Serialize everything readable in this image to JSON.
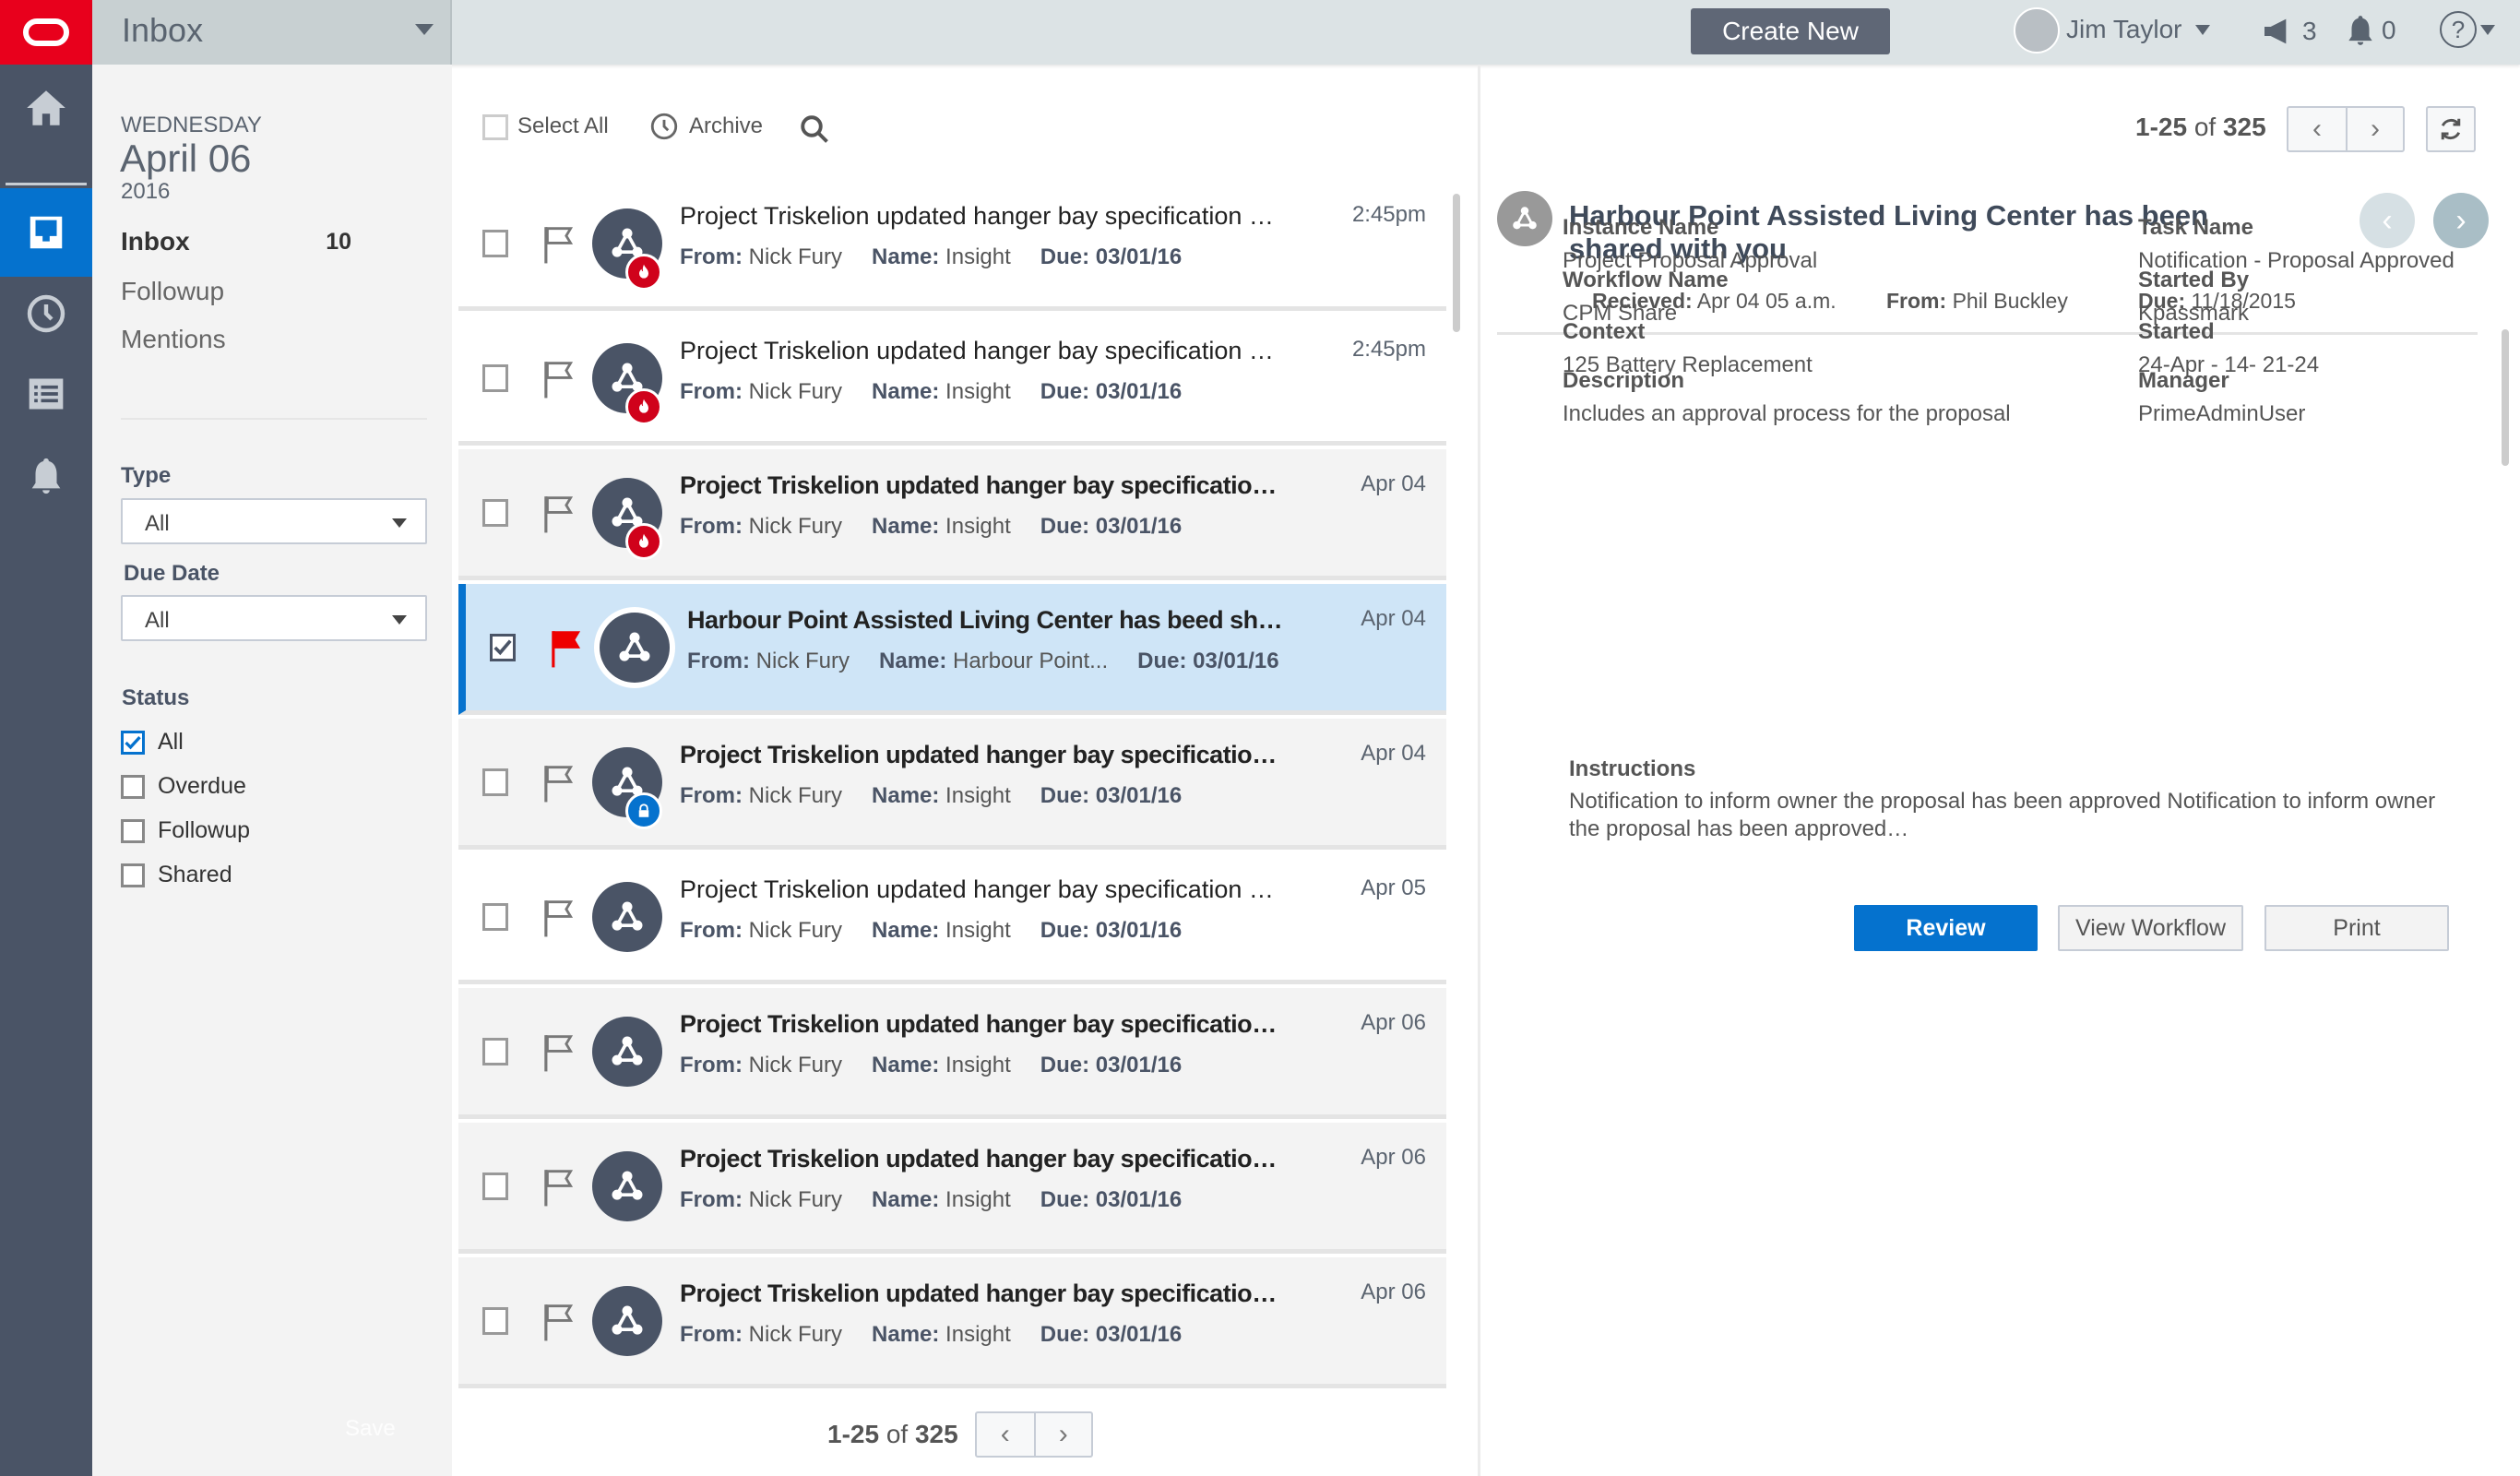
{
  "app": {
    "section_title": "Inbox",
    "create_new": "Create New",
    "user_name": "Jim Taylor",
    "announcements_count": "3",
    "notifications_count": "0",
    "help": "?",
    "accent": "#0572ce",
    "brand": "#e8001c"
  },
  "rail": {
    "items": [
      "home-icon",
      "inbox-icon",
      "history-icon",
      "list-icon",
      "bell-icon"
    ],
    "active": "inbox-icon"
  },
  "left": {
    "weekday": "WEDNESDAY",
    "date": "April 06",
    "year": "2016",
    "nav": [
      {
        "label": "Inbox",
        "count": "10"
      },
      {
        "label": "Followup"
      },
      {
        "label": "Mentions"
      }
    ],
    "type_label": "Type",
    "type_value": "All",
    "due_label": "Due Date",
    "due_value": "All",
    "status_label": "Status",
    "status": [
      {
        "label": "All",
        "checked": true
      },
      {
        "label": "Overdue",
        "checked": false
      },
      {
        "label": "Followup",
        "checked": false
      },
      {
        "label": "Shared",
        "checked": false
      }
    ],
    "save": "Save"
  },
  "toolbar": {
    "select_all": "Select All",
    "archive": "Archive",
    "pager": {
      "range": "1-25",
      "of": "of",
      "total": "325"
    }
  },
  "rows": [
    {
      "title": "Project Triskelion updated hanger bay specification are…",
      "from": "Nick Fury",
      "name": "Insight",
      "due": "03/01/16",
      "time": "2:45pm",
      "badge": "fire",
      "bold": false,
      "bg": "white"
    },
    {
      "title": "Project Triskelion updated hanger bay specification are…",
      "from": "Nick Fury",
      "name": "Insight",
      "due": "03/01/16",
      "time": "2:45pm",
      "badge": "fire",
      "bold": false,
      "bg": "white"
    },
    {
      "title": "Project Triskelion updated hanger bay specification...",
      "from": "Nick Fury",
      "name": "Insight",
      "due": "03/01/16",
      "time": "Apr 04",
      "badge": "fire",
      "bold": true,
      "bg": "grey"
    },
    {
      "title": "Harbour Point Assisted Living Center has beed shar...",
      "from": "Nick Fury",
      "name": "Harbour Point...",
      "due": "03/01/16",
      "time": "Apr 04",
      "badge": "",
      "bold": true,
      "bg": "selected",
      "checked": true,
      "flagged": true
    },
    {
      "title": "Project Triskelion updated hanger bay specification...",
      "from": "Nick Fury",
      "name": "Insight",
      "due": "03/01/16",
      "time": "Apr 04",
      "badge": "lock",
      "bold": true,
      "bg": "grey"
    },
    {
      "title": "Project Triskelion updated hanger bay specification are…",
      "from": "Nick Fury",
      "name": "Insight",
      "due": "03/01/16",
      "time": "Apr 05",
      "badge": "",
      "bold": false,
      "bg": "white"
    },
    {
      "title": "Project Triskelion updated hanger bay specification are...",
      "from": "Nick Fury",
      "name": "Insight",
      "due": "03/01/16",
      "time": "Apr 06",
      "badge": "",
      "bold": true,
      "bg": "grey"
    },
    {
      "title": "Project Triskelion updated hanger bay specification are...",
      "from": "Nick Fury",
      "name": "Insight",
      "due": "03/01/16",
      "time": "Apr 06",
      "badge": "",
      "bold": true,
      "bg": "grey"
    },
    {
      "title": "Project Triskelion updated hanger bay specification are...",
      "from": "Nick Fury",
      "name": "Insight",
      "due": "03/01/16",
      "time": "Apr 06",
      "badge": "",
      "bold": true,
      "bg": "grey"
    }
  ],
  "row_labels": {
    "from": "From:",
    "name": "Name:",
    "due": "Due:"
  },
  "detail": {
    "title": "Harbour Point Assisted Living Center has been shared with you",
    "received_label": "Recieved:",
    "received": "Apr 04 05 a.m.",
    "from_label": "From:",
    "from": "Phil Buckley",
    "due_label": "Due:",
    "due": "11/18/2015",
    "fields": [
      {
        "label": "Instance Name",
        "value": "Project Proposal Approval"
      },
      {
        "label": "Task Name",
        "value": "Notification - Proposal Approved"
      },
      {
        "label": "Workflow Name",
        "value": "CPM Share"
      },
      {
        "label": "Started By",
        "value": "Kpassmark"
      },
      {
        "label": "Context",
        "value": "125 Battery Replacement"
      },
      {
        "label": "Started",
        "value": "24-Apr - 14- 21-24"
      },
      {
        "label": "Description",
        "value": "Includes an approval process for the proposal"
      },
      {
        "label": "Manager",
        "value": "PrimeAdminUser"
      }
    ],
    "instructions_label": "Instructions",
    "instructions": "Notification to inform owner the proposal has been approved Notification to inform owner the proposal has been approved…",
    "buttons": {
      "review": "Review",
      "view_workflow": "View Workflow",
      "print": "Print"
    }
  }
}
